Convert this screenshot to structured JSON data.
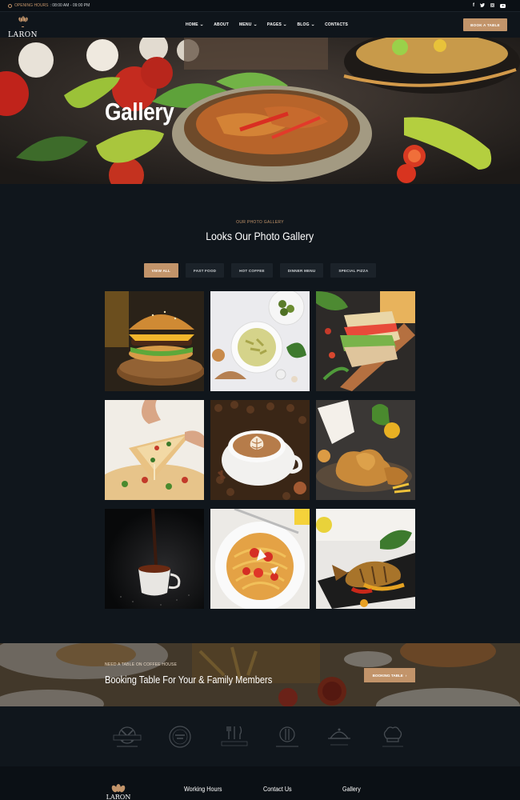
{
  "topbar": {
    "hours_label": "OPENING HOURS",
    "hours_value": ": 08:00 AM - 09:00 PM",
    "social": [
      "facebook-icon",
      "twitter-icon",
      "instagram-icon",
      "youtube-icon"
    ]
  },
  "nav": {
    "logo_text": "LARON",
    "items": [
      {
        "label": "HOME",
        "has_dropdown": true
      },
      {
        "label": "ABOUT",
        "has_dropdown": false
      },
      {
        "label": "MENU",
        "has_dropdown": true
      },
      {
        "label": "PAGES",
        "has_dropdown": true
      },
      {
        "label": "BLOG",
        "has_dropdown": true
      },
      {
        "label": "CONTACTS",
        "has_dropdown": false
      }
    ],
    "book_button": "BOOK A TABLE"
  },
  "hero": {
    "title": "Gallery"
  },
  "gallery": {
    "eyebrow": "OUR PHOTO GALLERY",
    "heading": "Looks Our Photo Gallery",
    "filters": [
      {
        "label": "VIEW ALL",
        "active": true
      },
      {
        "label": "FAST FOOD",
        "active": false
      },
      {
        "label": "HOT COFFEE",
        "active": false
      },
      {
        "label": "DINNER MENU",
        "active": false
      },
      {
        "label": "SPECIAL PIZZA",
        "active": false
      }
    ],
    "photos": [
      "burger",
      "pasta-penne",
      "sandwich",
      "pizza",
      "latte-art",
      "fried-chicken",
      "coffee-pour",
      "spaghetti",
      "grilled-fish"
    ]
  },
  "booking": {
    "eyebrow": "NEED A TABLE ON COFFEE HOUSE",
    "title": "Booking Table For Your & Family Members",
    "button": "BOOKING TABLE"
  },
  "footer": {
    "logo_text": "LARON",
    "columns": [
      "Working Hours",
      "Contact Us",
      "Gallery"
    ]
  },
  "colors": {
    "accent": "#c2946a",
    "background": "#10161c",
    "panel": "#1b2229"
  }
}
